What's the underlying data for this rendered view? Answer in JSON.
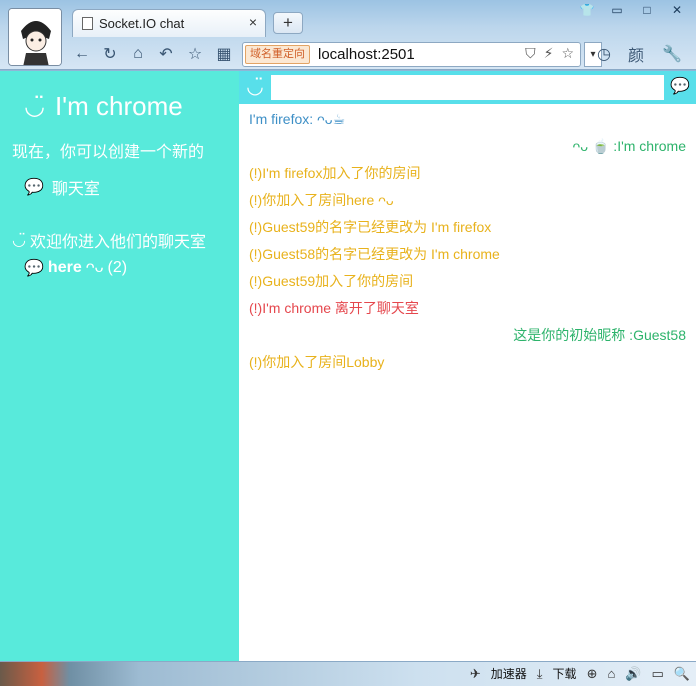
{
  "browser": {
    "tab_title": "Socket.IO chat",
    "tab_close": "×",
    "new_tab": "+",
    "redirect_badge": "域名重定向",
    "url": "localhost:2501",
    "dropdown": "▾",
    "window_buttons": [
      "👕",
      "▭",
      "□",
      "✕"
    ],
    "nav_icons": [
      "←",
      "↻",
      "⌂",
      "↶",
      "☆",
      "▦"
    ],
    "url_icons": [
      "⛉",
      "⚡",
      "☆"
    ],
    "right_icons": [
      "◷",
      "颜",
      "🔧"
    ]
  },
  "sidebar": {
    "nickname_icon": "◡̈",
    "nickname": "I'm chrome",
    "intro": "现在，你可以创建一个新的",
    "create_icon": "💬",
    "create_label": "聊天室",
    "welcome_icon": "◡̈",
    "welcome_text": "欢迎你进入他们的聊天室",
    "room_icon": "💬",
    "room_name": "here",
    "room_face": "ᴖᴗ",
    "room_count": "(2)"
  },
  "chat": {
    "input_placeholder": "",
    "input_value": "",
    "smile_icon": "◡̈",
    "send_icon": "💬",
    "messages": [
      {
        "side": "left",
        "color": "blue",
        "text": "I'm firefox:  ᴖᴗ☕"
      },
      {
        "side": "right",
        "color": "green",
        "text": "ᴖᴗ 🍵   :I'm chrome"
      },
      {
        "side": "left",
        "color": "orange",
        "text": "(!)I'm firefox加入了你的房间"
      },
      {
        "side": "left",
        "color": "orange",
        "text": "(!)你加入了房间here ᴖᴗ"
      },
      {
        "side": "left",
        "color": "orange",
        "text": "(!)Guest59的名字已经更改为 I'm firefox"
      },
      {
        "side": "left",
        "color": "orange",
        "text": "(!)Guest58的名字已经更改为 I'm chrome"
      },
      {
        "side": "left",
        "color": "orange",
        "text": "(!)Guest59加入了你的房间"
      },
      {
        "side": "left",
        "color": "red",
        "text": "(!)I'm chrome 离开了聊天室"
      },
      {
        "side": "right",
        "color": "green",
        "text": "这是你的初始昵称 :Guest58"
      },
      {
        "side": "left",
        "color": "orange",
        "text": "(!)你加入了房间Lobby"
      }
    ]
  },
  "statusbar": {
    "accelerator": "加速器",
    "download": "下载",
    "icons": [
      "⊕",
      "⌂",
      "🔊",
      "▭",
      "🔍"
    ]
  },
  "colors": {
    "sidebar_bg": "#58eadb",
    "input_bar_bg": "#58dfea",
    "blue": "#3d8fc6",
    "green": "#2db36b",
    "orange": "#e8b21c",
    "red": "#e5474d"
  }
}
